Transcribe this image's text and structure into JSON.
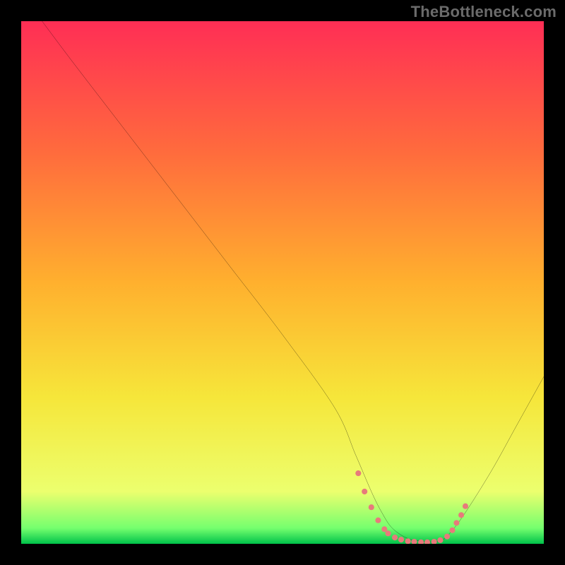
{
  "watermark": "TheBottleneck.com",
  "chart_data": {
    "type": "line",
    "title": "",
    "xlabel": "",
    "ylabel": "",
    "xlim": [
      0,
      100
    ],
    "ylim": [
      0,
      100
    ],
    "gradient_colors": {
      "top": "#ff2e55",
      "quarter": "#ff6b3d",
      "mid": "#ffb02e",
      "three_quarter": "#f6e63a",
      "near_bottom": "#ecff6e",
      "bottom_band": "#75ff6e",
      "bottom_line": "#00c24a"
    },
    "series": [
      {
        "name": "bottleneck-curve",
        "stroke": "#000000",
        "x": [
          4,
          10,
          20,
          30,
          40,
          50,
          60,
          64,
          67,
          69,
          71,
          74,
          77,
          80,
          82,
          85,
          90,
          95,
          100
        ],
        "y": [
          100,
          92,
          79,
          66,
          53,
          40,
          26,
          17,
          10,
          6,
          3,
          1,
          0.5,
          0.5,
          2,
          6,
          14,
          23,
          32
        ]
      }
    ],
    "markers": {
      "name": "optimal-range",
      "stroke": "#e77b7b",
      "fill": "#e77b7b",
      "x": [
        64.5,
        65.7,
        67.0,
        68.3,
        69.5,
        70.2,
        71.5,
        72.7,
        74.0,
        75.2,
        76.5,
        77.7,
        79.0,
        80.2,
        81.5,
        82.5,
        83.3,
        84.2,
        85.0
      ],
      "y": [
        13.5,
        10.0,
        7.0,
        4.5,
        2.8,
        2.0,
        1.2,
        0.8,
        0.5,
        0.4,
        0.3,
        0.3,
        0.4,
        0.7,
        1.4,
        2.6,
        4.0,
        5.5,
        7.2
      ]
    }
  }
}
